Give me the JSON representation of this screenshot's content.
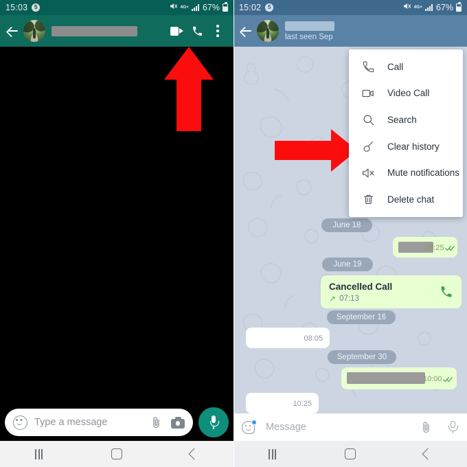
{
  "left_panel": {
    "app": "whatsapp",
    "status_bar": {
      "time": "15:03",
      "notification_count": "5",
      "network_type": "4G+",
      "battery_percent": "67%",
      "icons": [
        "mute-icon",
        "network-4g-plus-icon",
        "signal-bars-icon",
        "battery-icon"
      ]
    },
    "header": {
      "back_icon": "back-arrow-icon",
      "avatar": "contact-avatar",
      "contact_name_redacted": "",
      "video_call_icon": "video-call-icon",
      "voice_call_icon": "phone-call-icon",
      "overflow_icon": "more-options-icon",
      "background_color": "#0f6b5c"
    },
    "annotation": {
      "type": "arrow-up",
      "color": "#fb0d0d",
      "points_to": "phone-call-icon"
    },
    "composer": {
      "emoji_icon": "emoji-icon",
      "placeholder": "Type a message",
      "attach_icon": "attachment-clip-icon",
      "camera_icon": "camera-icon",
      "mic_icon": "microphone-icon",
      "mic_button_color": "#0d8f7b"
    },
    "nav_bar": {
      "recents": "recents-icon",
      "home": "home-icon",
      "back": "back-icon"
    }
  },
  "right_panel": {
    "app": "telegram",
    "status_bar": {
      "time": "15:02",
      "notification_count": "5",
      "network_type": "4G+",
      "battery_percent": "67%",
      "icons": [
        "mute-icon",
        "network-4g-plus-icon",
        "signal-bars-icon",
        "battery-icon"
      ]
    },
    "header": {
      "back_icon": "back-arrow-icon",
      "avatar": "contact-avatar",
      "contact_name_redacted": "",
      "subtitle": "last seen Sep",
      "background_color": "#5a82a6"
    },
    "annotation": {
      "type": "arrow-right",
      "color": "#fb0d0d",
      "points_to": "overflow-menu"
    },
    "menu": {
      "items": [
        {
          "label": "Call",
          "icon": "phone-call-icon"
        },
        {
          "label": "Video Call",
          "icon": "video-call-icon"
        },
        {
          "label": "Search",
          "icon": "search-icon"
        },
        {
          "label": "Clear history",
          "icon": "broom-icon"
        },
        {
          "label": "Mute notifications",
          "icon": "mute-bell-icon"
        },
        {
          "label": "Delete chat",
          "icon": "trash-icon"
        }
      ]
    },
    "chat": {
      "wallpaper": "doodle-pattern",
      "background_color": "#ccd5e1",
      "date_separators": [
        "June 18",
        "June 19",
        "September 16",
        "September 30"
      ],
      "messages": [
        {
          "direction": "out",
          "redacted": true,
          "time": "19:25",
          "status": "read",
          "date": "June 18"
        },
        {
          "direction": "out",
          "type": "call",
          "title": "Cancelled Call",
          "time": "07:13",
          "direction_arrow": "outgoing",
          "date": "June 19"
        },
        {
          "direction": "in",
          "redacted": true,
          "time": "08:05",
          "date": "September 16"
        },
        {
          "direction": "out",
          "redacted": true,
          "time": "10:00",
          "status": "read",
          "date": "September 30"
        },
        {
          "direction": "in",
          "redacted": true,
          "time": "10:25",
          "date": "September 30"
        }
      ]
    },
    "composer": {
      "emoji_icon": "sticker-emoji-icon",
      "placeholder": "Message",
      "attach_icon": "attachment-clip-icon",
      "mic_icon": "microphone-icon"
    },
    "nav_bar": {
      "recents": "recents-icon",
      "home": "home-icon",
      "back": "back-icon"
    }
  }
}
